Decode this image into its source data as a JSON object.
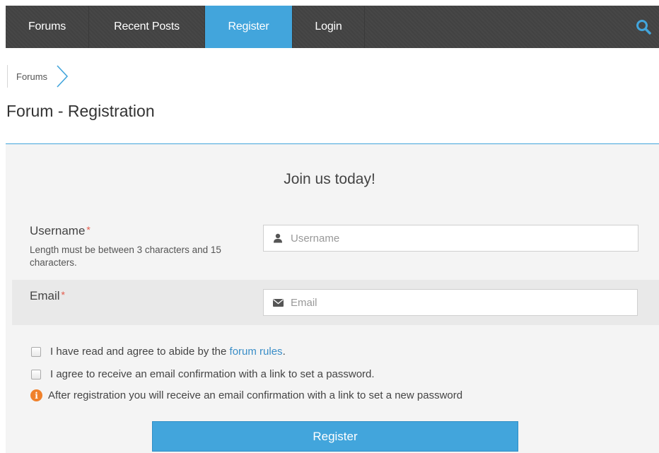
{
  "nav": {
    "items": [
      {
        "label": "Forums"
      },
      {
        "label": "Recent Posts"
      },
      {
        "label": "Register"
      },
      {
        "label": "Login"
      }
    ],
    "active": "Register",
    "search_icon": "search-icon",
    "accent": "#42a5dc"
  },
  "breadcrumb": {
    "items": [
      "Forums"
    ]
  },
  "page": {
    "title": "Forum - Registration"
  },
  "form": {
    "heading": "Join us today!",
    "username": {
      "label": "Username",
      "required_mark": "*",
      "hint": "Length must be between 3 characters and 15 characters.",
      "placeholder": "Username",
      "value": ""
    },
    "email": {
      "label": "Email",
      "required_mark": "*",
      "placeholder": "Email",
      "value": ""
    },
    "agree_rules": {
      "text_before": "I have read and agree to abide by the ",
      "link": "forum rules",
      "text_after": ".",
      "checked": false
    },
    "agree_email": {
      "text": "I agree to receive an email confirmation with a link to set a password.",
      "checked": false
    },
    "info": {
      "icon": "info-icon",
      "text": "After registration you will receive an email confirmation with a link to set a new password"
    },
    "submit_label": "Register"
  }
}
